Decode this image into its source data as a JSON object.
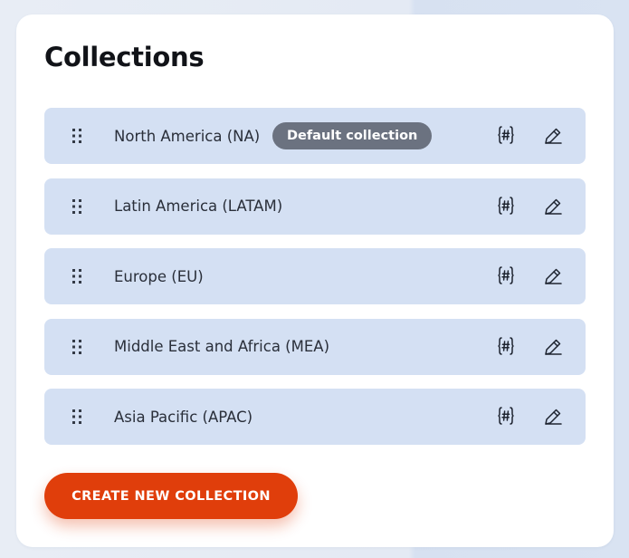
{
  "page": {
    "title": "Collections"
  },
  "collections": [
    {
      "name": "North America (NA)",
      "badge": "Default collection"
    },
    {
      "name": "Latin America (LATAM)"
    },
    {
      "name": "Europe (EU)"
    },
    {
      "name": "Middle East and Africa (MEA)"
    },
    {
      "name": "Asia Pacific (APAC)"
    }
  ],
  "icons": {
    "drag": "drag-handle-icon",
    "variables": "variables-icon",
    "edit": "pencil-icon"
  },
  "actions": {
    "create_label": "CREATE NEW COLLECTION"
  },
  "colors": {
    "row_bg": "#d4e0f3",
    "badge_bg": "#6b7280",
    "primary": "#e03e0b",
    "card_bg": "#ffffff"
  }
}
